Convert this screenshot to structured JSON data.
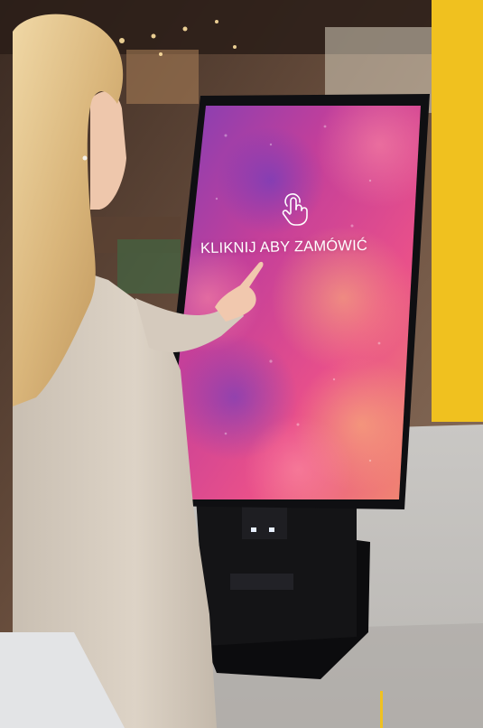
{
  "kiosk": {
    "screen_prompt": "KLIKNIJ ABY ZAMÓWIĆ",
    "prompt_icon": "tap-hand-icon"
  },
  "colors": {
    "accent_yellow": "#F0C11F",
    "kiosk_body": "#141416",
    "screen_pink": "#E8477E",
    "screen_purple": "#6B3FB6",
    "screen_orange": "#F59160",
    "panel_gray": "#E3E4E6"
  }
}
